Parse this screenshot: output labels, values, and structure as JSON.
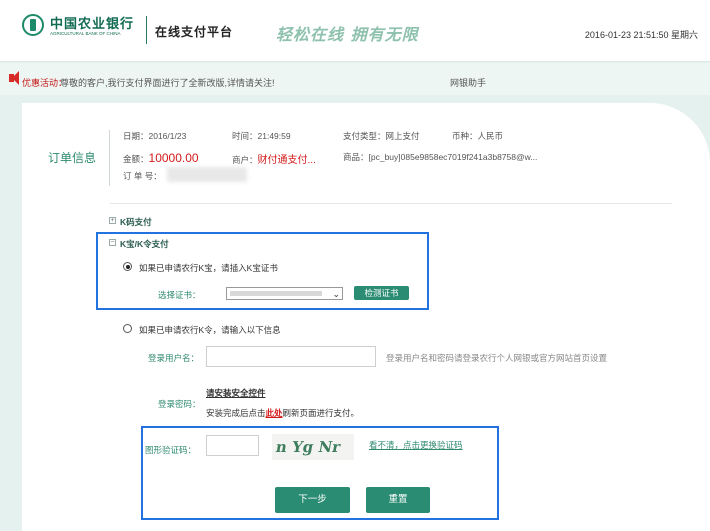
{
  "header": {
    "bank_name_cn": "中国农业银行",
    "bank_name_en": "AGRICULTURAL BANK OF CHINA",
    "platform": "在线支付平台",
    "slogan": "轻松在线  拥有无限",
    "datetime": "2016-01-23 21:51:50 星期六"
  },
  "notice": {
    "tag": "优惠活动：",
    "text": "尊敬的客户,我行支付界面进行了全新改版,详情请关注!",
    "helper": "网银助手"
  },
  "order": {
    "section_label": "订单信息",
    "date": "日期：2016/1/23",
    "time": "时间：21:49:59",
    "pay_type": "支付类型：网上支付",
    "currency": "币种：人民币",
    "amount_label": "金额：",
    "amount_value": "10000.00",
    "merchant_label": "商户：",
    "merchant_value": "财付通支付...",
    "goods": "商品：[pc_buy]085e9858ec7019f241a3b8758@w...",
    "order_no_label": "订 单 号："
  },
  "kcode": {
    "title": "K码支付"
  },
  "kbao": {
    "title": "K宝/K令支付",
    "option_kbao": "如果已申请农行K宝，请插入K宝证书",
    "cert_label": "选择证书：",
    "cert_btn": "检测证书",
    "option_kling": "如果已申请农行K令，请输入以下信息",
    "username_label": "登录用户名：",
    "username_hint": "登录用户名和密码请登录农行个人网银或官方网站首页设置",
    "password_label": "登录密码：",
    "install_link": "请安装安全控件",
    "install_before": "安装完成后点击",
    "install_here": "此处",
    "install_after": "刷新页面进行支付。",
    "captcha_label": "图形验证码：",
    "captcha_text": "n Yg Nr",
    "captcha_refresh": "看不清，点击更换验证码",
    "next_btn": "下一步",
    "reset_btn": "重置"
  },
  "colors": {
    "brand": "#2a8c72",
    "accent_red": "#d41a1a",
    "highlight": "#2272e0"
  }
}
